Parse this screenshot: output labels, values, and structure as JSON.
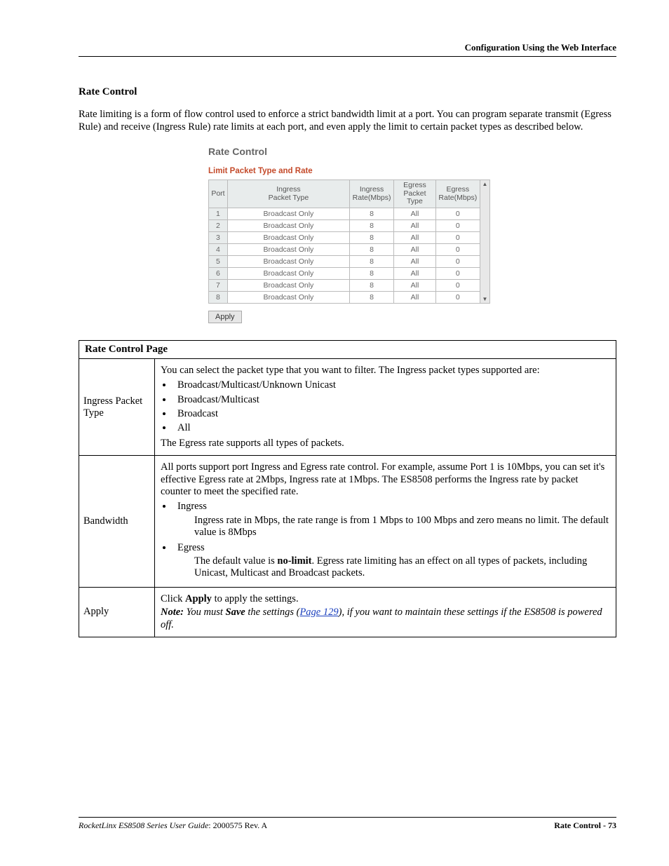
{
  "header": {
    "right": "Configuration Using the Web Interface"
  },
  "section": {
    "title": "Rate Control"
  },
  "intro": "Rate limiting is a form of flow control used to enforce a strict bandwidth limit at a port. You can program separate transmit (Egress Rule) and receive (Ingress Rule) rate limits at each port, and even apply the limit to certain packet types as described below.",
  "ui": {
    "heading": "Rate Control",
    "subheading": "Limit Packet Type and Rate",
    "columns": {
      "port": "Port",
      "ingress_type": "Ingress\nPacket Type",
      "ingress_rate": "Ingress\nRate(Mbps)",
      "egress_type": "Egress\nPacket Type",
      "egress_rate": "Egress\nRate(Mbps)"
    },
    "rows": [
      {
        "port": "1",
        "itype": "Broadcast Only",
        "irate": "8",
        "etype": "All",
        "erate": "0"
      },
      {
        "port": "2",
        "itype": "Broadcast Only",
        "irate": "8",
        "etype": "All",
        "erate": "0"
      },
      {
        "port": "3",
        "itype": "Broadcast Only",
        "irate": "8",
        "etype": "All",
        "erate": "0"
      },
      {
        "port": "4",
        "itype": "Broadcast Only",
        "irate": "8",
        "etype": "All",
        "erate": "0"
      },
      {
        "port": "5",
        "itype": "Broadcast Only",
        "irate": "8",
        "etype": "All",
        "erate": "0"
      },
      {
        "port": "6",
        "itype": "Broadcast Only",
        "irate": "8",
        "etype": "All",
        "erate": "0"
      },
      {
        "port": "7",
        "itype": "Broadcast Only",
        "irate": "8",
        "etype": "All",
        "erate": "0"
      },
      {
        "port": "8",
        "itype": "Broadcast Only",
        "irate": "8",
        "etype": "All",
        "erate": "0"
      }
    ],
    "apply": "Apply"
  },
  "desc": {
    "table_title": "Rate Control Page",
    "rows": {
      "ingress": {
        "label": "Ingress Packet Type",
        "intro": "You can select the packet type that you want to filter. The Ingress packet types supported are:",
        "items": [
          "Broadcast/Multicast/Unknown Unicast",
          "Broadcast/Multicast",
          "Broadcast",
          "All"
        ],
        "outro": "The Egress rate supports all types of packets."
      },
      "bandwidth": {
        "label": "Bandwidth",
        "intro": "All ports support port Ingress and Egress rate control. For example, assume Port 1 is 10Mbps, you can set it's effective Egress rate at 2Mbps, Ingress rate at 1Mbps. The ES8508 performs the Ingress rate by packet counter to meet the specified rate.",
        "item1": "Ingress",
        "item1_sub": "Ingress rate in Mbps, the rate range is from 1 Mbps to 100 Mbps and zero means no limit. The default value is 8Mbps",
        "item2": "Egress",
        "item2_sub_pre": "The default value is ",
        "item2_sub_bold": "no-limit",
        "item2_sub_post": ". Egress rate limiting has an effect on all types of packets, including Unicast, Multicast and Broadcast packets."
      },
      "apply": {
        "label": "Apply",
        "line1_pre": "Click ",
        "line1_bold": "Apply",
        "line1_post": " to apply the settings.",
        "note_label": "Note:",
        "note_pre": " You must ",
        "note_bold": "Save",
        "note_mid": " the settings (",
        "note_link": "Page 129",
        "note_post": "), if you want to maintain these settings if the ES8508 is powered off."
      }
    }
  },
  "footer": {
    "left_italic": "RocketLinx ES8508 Series  User Guide",
    "left_rest": ": 2000575 Rev. A",
    "right_label": "Rate Control - 73"
  }
}
